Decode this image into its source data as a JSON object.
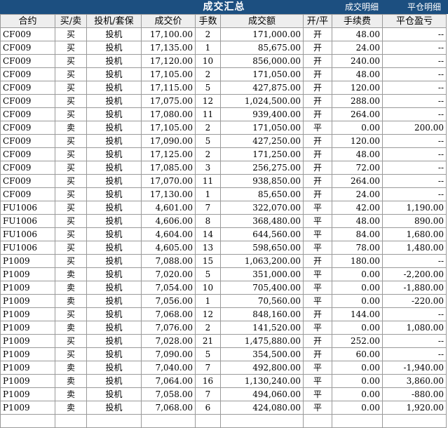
{
  "window": {
    "title": "成交汇总",
    "links": {
      "trade_detail": "成交明细",
      "close_detail": "平仓明细"
    }
  },
  "columns": [
    "合约",
    "买/卖",
    "投机/套保",
    "成交价",
    "手数",
    "成交额",
    "开/平",
    "手续费",
    "平仓盈亏"
  ],
  "rows": [
    [
      "CF009",
      "买",
      "投机",
      "17,100.00",
      "2",
      "171,000.00",
      "开",
      "48.00",
      "--"
    ],
    [
      "CF009",
      "买",
      "投机",
      "17,135.00",
      "1",
      "85,675.00",
      "开",
      "24.00",
      "--"
    ],
    [
      "CF009",
      "买",
      "投机",
      "17,120.00",
      "10",
      "856,000.00",
      "开",
      "240.00",
      "--"
    ],
    [
      "CF009",
      "买",
      "投机",
      "17,105.00",
      "2",
      "171,050.00",
      "开",
      "48.00",
      "--"
    ],
    [
      "CF009",
      "买",
      "投机",
      "17,115.00",
      "5",
      "427,875.00",
      "开",
      "120.00",
      "--"
    ],
    [
      "CF009",
      "买",
      "投机",
      "17,075.00",
      "12",
      "1,024,500.00",
      "开",
      "288.00",
      "--"
    ],
    [
      "CF009",
      "买",
      "投机",
      "17,080.00",
      "11",
      "939,400.00",
      "开",
      "264.00",
      "--"
    ],
    [
      "CF009",
      "卖",
      "投机",
      "17,105.00",
      "2",
      "171,050.00",
      "平",
      "0.00",
      "200.00"
    ],
    [
      "CF009",
      "买",
      "投机",
      "17,090.00",
      "5",
      "427,250.00",
      "开",
      "120.00",
      "--"
    ],
    [
      "CF009",
      "买",
      "投机",
      "17,125.00",
      "2",
      "171,250.00",
      "开",
      "48.00",
      "--"
    ],
    [
      "CF009",
      "买",
      "投机",
      "17,085.00",
      "3",
      "256,275.00",
      "开",
      "72.00",
      "--"
    ],
    [
      "CF009",
      "买",
      "投机",
      "17,070.00",
      "11",
      "938,850.00",
      "开",
      "264.00",
      "--"
    ],
    [
      "CF009",
      "买",
      "投机",
      "17,130.00",
      "1",
      "85,650.00",
      "开",
      "24.00",
      "--"
    ],
    [
      "FU1006",
      "买",
      "投机",
      "4,601.00",
      "7",
      "322,070.00",
      "平",
      "42.00",
      "1,190.00"
    ],
    [
      "FU1006",
      "买",
      "投机",
      "4,606.00",
      "8",
      "368,480.00",
      "平",
      "48.00",
      "890.00"
    ],
    [
      "FU1006",
      "买",
      "投机",
      "4,604.00",
      "14",
      "644,560.00",
      "平",
      "84.00",
      "1,680.00"
    ],
    [
      "FU1006",
      "买",
      "投机",
      "4,605.00",
      "13",
      "598,650.00",
      "平",
      "78.00",
      "1,480.00"
    ],
    [
      "P1009",
      "买",
      "投机",
      "7,088.00",
      "15",
      "1,063,200.00",
      "开",
      "180.00",
      "--"
    ],
    [
      "P1009",
      "卖",
      "投机",
      "7,020.00",
      "5",
      "351,000.00",
      "平",
      "0.00",
      "-2,200.00"
    ],
    [
      "P1009",
      "卖",
      "投机",
      "7,054.00",
      "10",
      "705,400.00",
      "平",
      "0.00",
      "-1,880.00"
    ],
    [
      "P1009",
      "卖",
      "投机",
      "7,056.00",
      "1",
      "70,560.00",
      "平",
      "0.00",
      "-220.00"
    ],
    [
      "P1009",
      "买",
      "投机",
      "7,068.00",
      "12",
      "848,160.00",
      "开",
      "144.00",
      "--"
    ],
    [
      "P1009",
      "卖",
      "投机",
      "7,076.00",
      "2",
      "141,520.00",
      "平",
      "0.00",
      "1,080.00"
    ],
    [
      "P1009",
      "买",
      "投机",
      "7,028.00",
      "21",
      "1,475,880.00",
      "开",
      "252.00",
      "--"
    ],
    [
      "P1009",
      "买",
      "投机",
      "7,090.00",
      "5",
      "354,500.00",
      "开",
      "60.00",
      "--"
    ],
    [
      "P1009",
      "卖",
      "投机",
      "7,040.00",
      "7",
      "492,800.00",
      "平",
      "0.00",
      "-1,940.00"
    ],
    [
      "P1009",
      "卖",
      "投机",
      "7,064.00",
      "16",
      "1,130,240.00",
      "平",
      "0.00",
      "3,860.00"
    ],
    [
      "P1009",
      "卖",
      "投机",
      "7,058.00",
      "7",
      "494,060.00",
      "平",
      "0.00",
      "-880.00"
    ],
    [
      "P1009",
      "卖",
      "投机",
      "7,068.00",
      "6",
      "424,080.00",
      "平",
      "0.00",
      "1,920.00"
    ],
    [
      "",
      "",
      "",
      "",
      "",
      "",
      "",
      "",
      ""
    ]
  ]
}
